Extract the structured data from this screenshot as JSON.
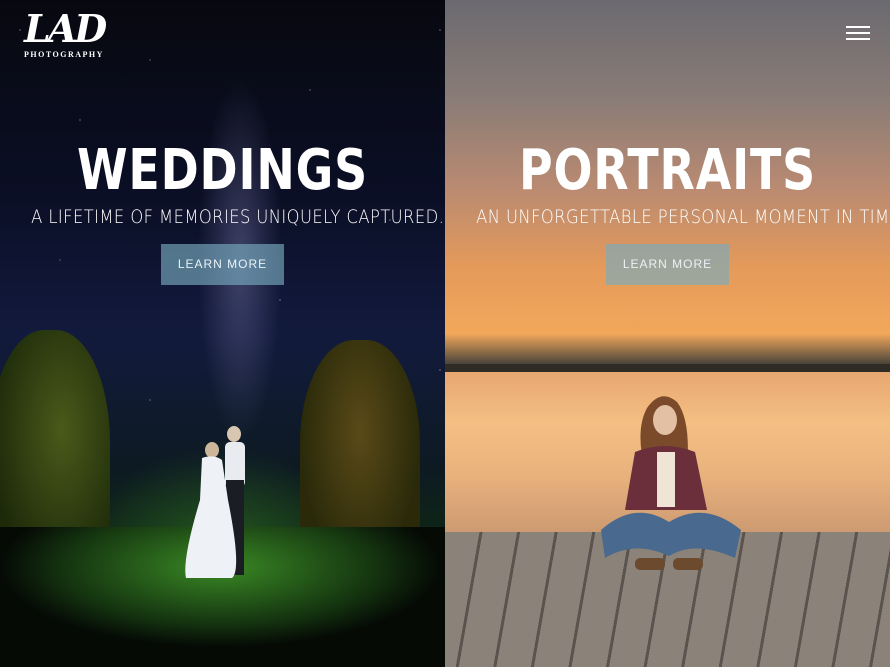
{
  "brand": {
    "logo_mark": "LAD",
    "logo_sub": "PHOTOGRAPHY"
  },
  "nav": {
    "menu_icon": "hamburger-menu-icon"
  },
  "panels": [
    {
      "headline": "WEDDINGS",
      "tagline": "A LIFETIME OF MEMORIES UNIQUELY CAPTURED.",
      "button_label": "LEARN MORE"
    },
    {
      "headline": "PORTRAITS",
      "tagline": "AN UNFORGETTABLE PERSONAL MOMENT IN TIME.",
      "button_label": "LEARN MORE"
    }
  ],
  "colors": {
    "button_bg": "#78AABE",
    "text": "#FFFFFF"
  }
}
